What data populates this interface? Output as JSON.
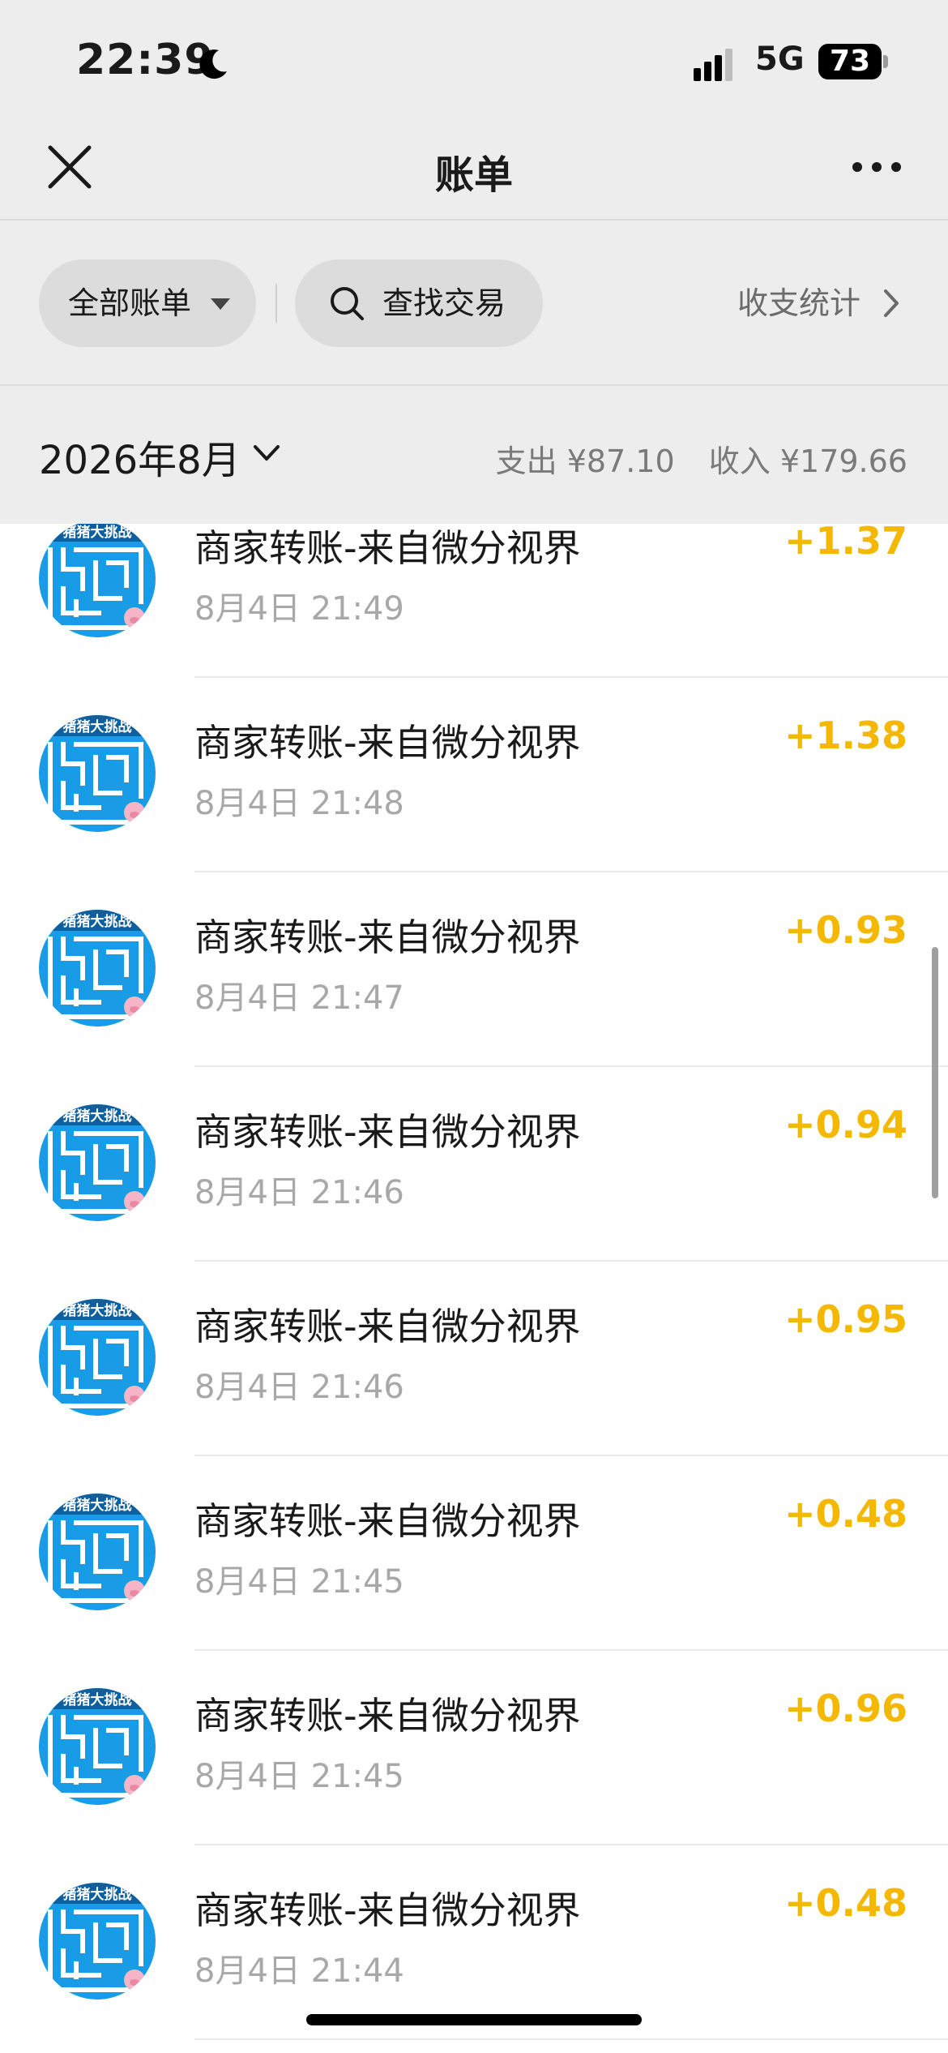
{
  "status_bar": {
    "time": "22:39",
    "network": "5G",
    "battery": "73"
  },
  "nav": {
    "title": "账单"
  },
  "filters": {
    "all_bills_label": "全部账单",
    "search_label": "查找交易",
    "stats_label": "收支统计"
  },
  "month_bar": {
    "month": "2026年8月",
    "expense": "支出 ¥87.10",
    "income": "收入 ¥179.66"
  },
  "transactions": [
    {
      "title": "商家转账-来自微分视界",
      "time": "8月4日 21:49",
      "amount": "+1.37"
    },
    {
      "title": "商家转账-来自微分视界",
      "time": "8月4日 21:48",
      "amount": "+1.38"
    },
    {
      "title": "商家转账-来自微分视界",
      "time": "8月4日 21:47",
      "amount": "+0.93"
    },
    {
      "title": "商家转账-来自微分视界",
      "time": "8月4日 21:46",
      "amount": "+0.94"
    },
    {
      "title": "商家转账-来自微分视界",
      "time": "8月4日 21:46",
      "amount": "+0.95"
    },
    {
      "title": "商家转账-来自微分视界",
      "time": "8月4日 21:45",
      "amount": "+0.48"
    },
    {
      "title": "商家转账-来自微分视界",
      "time": "8月4日 21:45",
      "amount": "+0.96"
    },
    {
      "title": "商家转账-来自微分视界",
      "time": "8月4日 21:44",
      "amount": "+0.48"
    }
  ],
  "avatar_badge": "猪猪大挑战",
  "colors": {
    "income_amount": "#f5b800",
    "background_gray": "#ededed",
    "avatar_blue": "#1a9be6"
  }
}
